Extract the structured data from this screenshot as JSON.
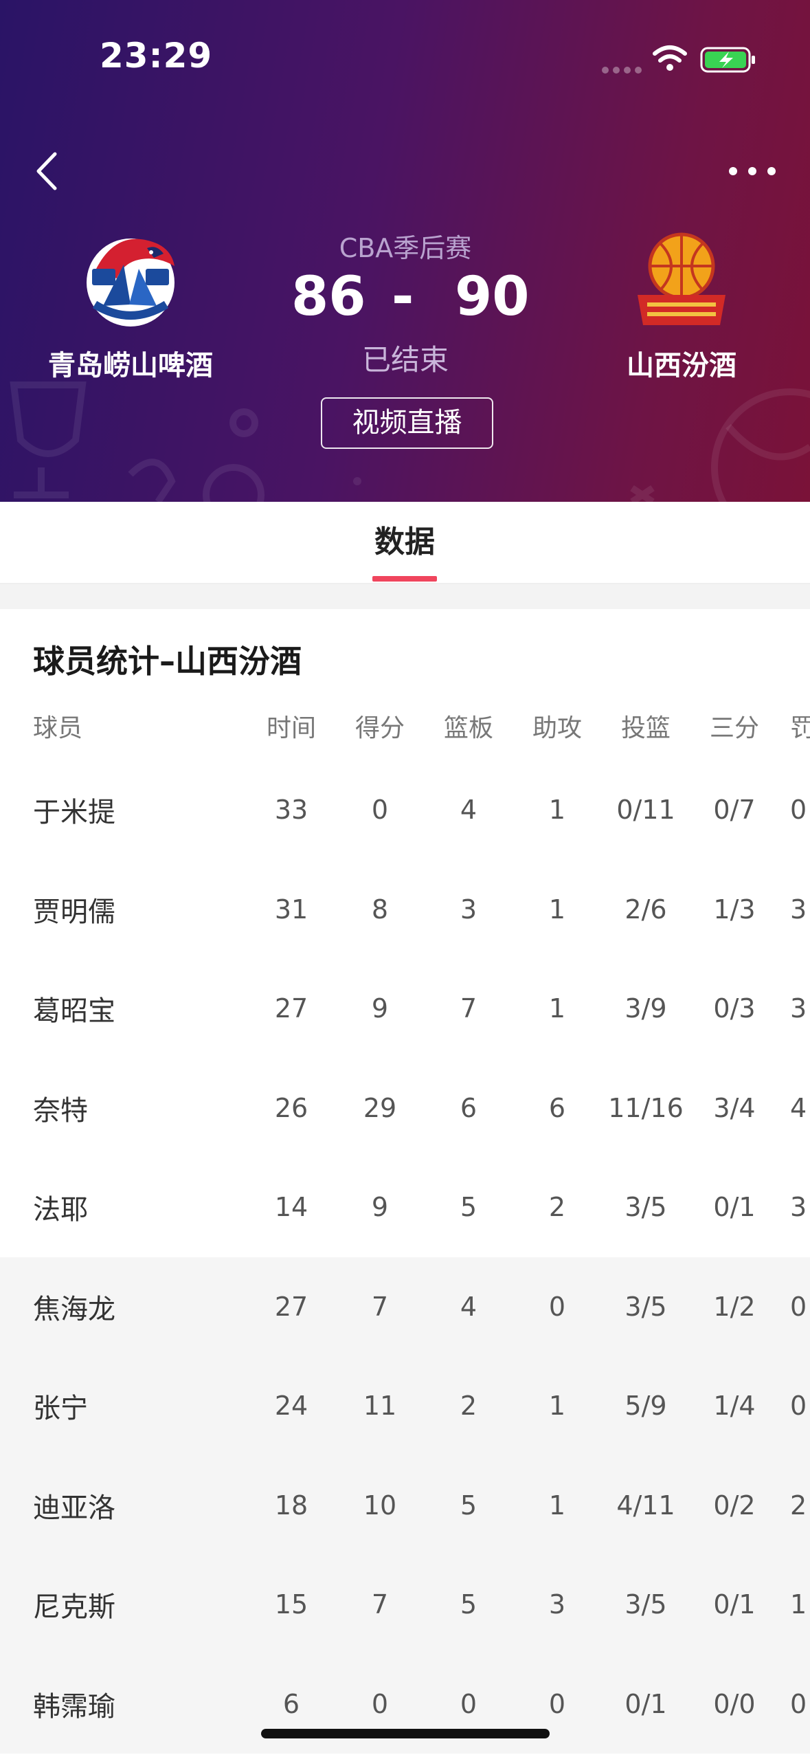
{
  "status_bar": {
    "time": "23:29"
  },
  "header": {
    "league": "CBA季后赛",
    "home_team": {
      "name": "青岛崂山啤酒",
      "score": "86"
    },
    "away_team": {
      "name": "山西汾酒",
      "score": "90"
    },
    "score_separator": "-",
    "game_status": "已结束",
    "video_button": "视频直播"
  },
  "tabs": [
    {
      "label": "数据",
      "active": true
    }
  ],
  "stats": {
    "title": "球员统计–山西汾酒",
    "columns": [
      "球员",
      "时间",
      "得分",
      "篮板",
      "助攻",
      "投篮",
      "三分",
      "罚"
    ],
    "rows": [
      {
        "name": "于米提",
        "min": "33",
        "pts": "0",
        "reb": "4",
        "ast": "1",
        "fg": "0/11",
        "tp": "0/7",
        "ft": "0",
        "starter": true
      },
      {
        "name": "贾明儒",
        "min": "31",
        "pts": "8",
        "reb": "3",
        "ast": "1",
        "fg": "2/6",
        "tp": "1/3",
        "ft": "3",
        "starter": true
      },
      {
        "name": "葛昭宝",
        "min": "27",
        "pts": "9",
        "reb": "7",
        "ast": "1",
        "fg": "3/9",
        "tp": "0/3",
        "ft": "3",
        "starter": true
      },
      {
        "name": "奈特",
        "min": "26",
        "pts": "29",
        "reb": "6",
        "ast": "6",
        "fg": "11/16",
        "tp": "3/4",
        "ft": "4",
        "starter": true
      },
      {
        "name": "法耶",
        "min": "14",
        "pts": "9",
        "reb": "5",
        "ast": "2",
        "fg": "3/5",
        "tp": "0/1",
        "ft": "3",
        "starter": true
      },
      {
        "name": "焦海龙",
        "min": "27",
        "pts": "7",
        "reb": "4",
        "ast": "0",
        "fg": "3/5",
        "tp": "1/2",
        "ft": "0",
        "starter": false
      },
      {
        "name": "张宁",
        "min": "24",
        "pts": "11",
        "reb": "2",
        "ast": "1",
        "fg": "5/9",
        "tp": "1/4",
        "ft": "0",
        "starter": false
      },
      {
        "name": "迪亚洛",
        "min": "18",
        "pts": "10",
        "reb": "5",
        "ast": "1",
        "fg": "4/11",
        "tp": "0/2",
        "ft": "2",
        "starter": false
      },
      {
        "name": "尼克斯",
        "min": "15",
        "pts": "7",
        "reb": "5",
        "ast": "3",
        "fg": "3/5",
        "tp": "0/1",
        "ft": "1",
        "starter": false
      },
      {
        "name": "韩霈瑜",
        "min": "6",
        "pts": "0",
        "reb": "0",
        "ast": "0",
        "fg": "0/1",
        "tp": "0/0",
        "ft": "0",
        "starter": false
      }
    ]
  },
  "colors": {
    "accent": "#f0455d",
    "header_start": "#2a1466",
    "header_end": "#7a1238",
    "bench_bg": "#f5f5f5"
  },
  "icons": [
    "back-icon",
    "more-icon",
    "signal-icon",
    "wifi-icon",
    "battery-charging-icon"
  ]
}
